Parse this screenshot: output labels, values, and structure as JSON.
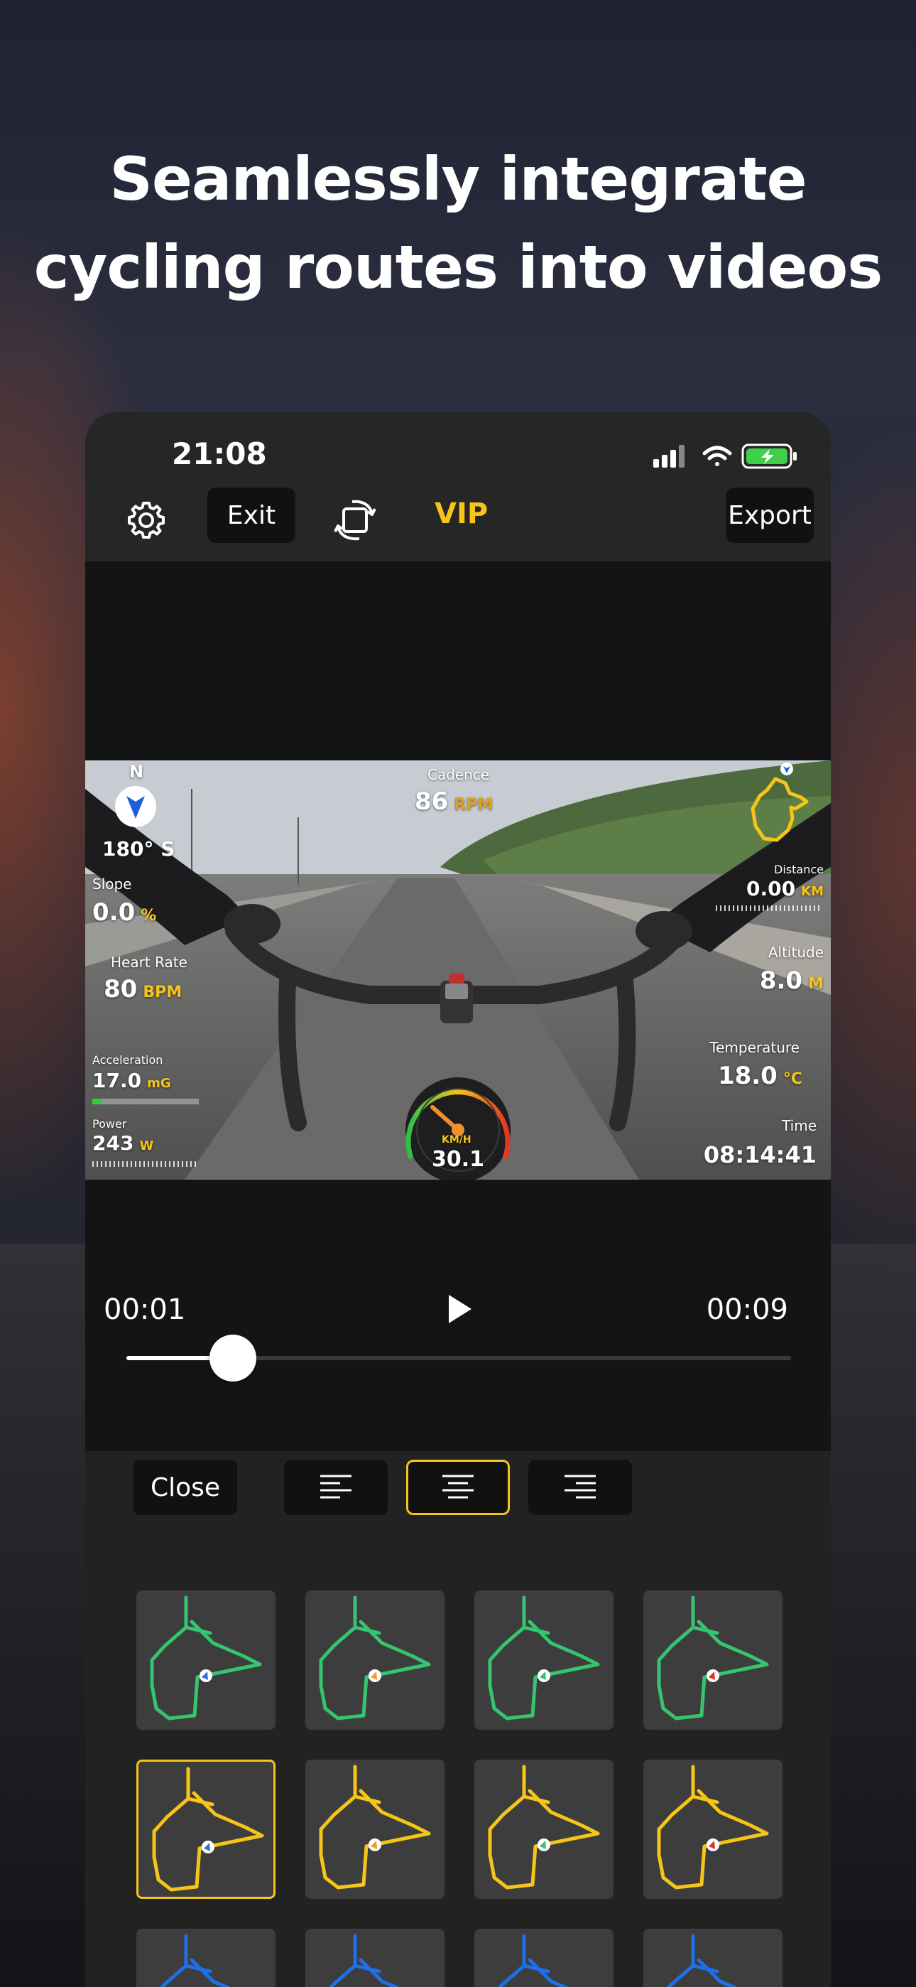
{
  "headline": {
    "line1": "Seamlessly integrate",
    "line2": "cycling routes into videos"
  },
  "status_bar": {
    "time": "21:08",
    "icons": [
      "signal-icon",
      "wifi-icon",
      "battery-charging-icon"
    ]
  },
  "toolbar": {
    "settings_icon": "gear-icon",
    "exit_label": "Exit",
    "rotate_icon": "rotate-icon",
    "vip_label": "VIP",
    "export_label": "Export"
  },
  "overlay": {
    "compass_n": "N",
    "heading": "180° S",
    "cadence_label": "Cadence",
    "cadence_value": "86",
    "cadence_unit": "RPM",
    "slope_label": "Slope",
    "slope_value": "0.0",
    "slope_unit": "%",
    "heart_label": "Heart Rate",
    "heart_value": "80",
    "heart_unit": "BPM",
    "accel_label": "Acceleration",
    "accel_value": "17.0",
    "accel_unit": "mG",
    "power_label": "Power",
    "power_value": "243",
    "power_unit": "W",
    "distance_label": "Distance",
    "distance_value": "0.00",
    "distance_unit": "KM",
    "altitude_label": "Altitude",
    "altitude_value": "8.0",
    "altitude_unit": "M",
    "temp_label": "Temperature",
    "temp_value": "18.0",
    "temp_unit": "°C",
    "time_label": "Time",
    "time_value": "08:14:41",
    "speed_unit": "KM/H",
    "speed_value": "30.1"
  },
  "player": {
    "current_time": "00:01",
    "end_time": "00:09",
    "progress": 0.16
  },
  "panel": {
    "close_label": "Close",
    "align_options": [
      "align-left-icon",
      "align-center-icon",
      "align-right-icon"
    ],
    "selected_align": 1,
    "route_colors": [
      "#35c46f",
      "#f5c518",
      "#1e6fe8"
    ],
    "marker_colors": [
      "#3a6fd8",
      "#f0a020",
      "#35c46f",
      "#e03030"
    ],
    "selected_tile": {
      "row": 1,
      "col": 0
    }
  },
  "colors": {
    "accent": "#f5c518",
    "background": "#141414",
    "toolbar": "#262626"
  }
}
